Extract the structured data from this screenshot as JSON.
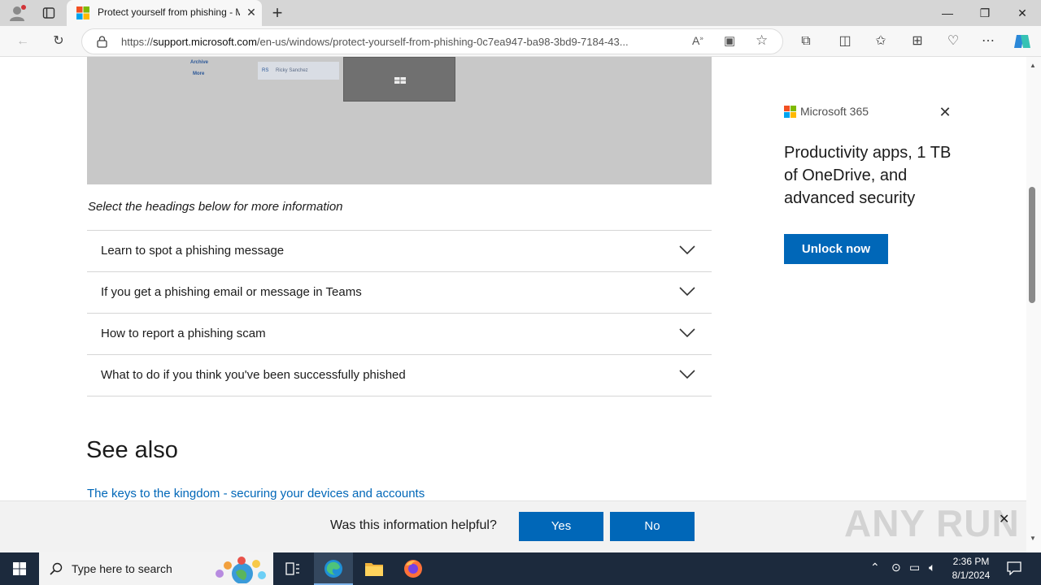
{
  "browser": {
    "tab_title": "Protect yourself from phishing - Microsoft Support",
    "url_domain": "support.microsoft.com",
    "url_scheme": "https://",
    "url_path": "/en-us/windows/protect-yourself-from-phishing-0c7ea947-ba98-3bd9-7184-43..."
  },
  "hero": {
    "link_archive": "Archive",
    "link_more": "More",
    "user_initials": "RS",
    "user_name": "Ricky Sanchez"
  },
  "content": {
    "intro": "Select the headings below for more information",
    "accordions": [
      {
        "label": "Learn to spot a phishing message"
      },
      {
        "label": "If you get a phishing email or message in Teams"
      },
      {
        "label": "How to report a phishing scam"
      },
      {
        "label": "What to do if you think you've been successfully phished"
      }
    ],
    "see_also_heading": "See also",
    "see_also_link": "The keys to the kingdom - securing your devices and accounts"
  },
  "ad": {
    "brand": "Microsoft 365",
    "text": "Productivity apps, 1 TB of OneDrive, and advanced security",
    "button": "Unlock now"
  },
  "feedback": {
    "question": "Was this information helpful?",
    "yes": "Yes",
    "no": "No"
  },
  "watermark": "ANY RUN",
  "taskbar": {
    "search_placeholder": "Type here to search",
    "time": "2:36 PM",
    "date": "8/1/2024"
  },
  "colors": {
    "accent": "#0067b8",
    "taskbar": "#1c2a3d"
  }
}
